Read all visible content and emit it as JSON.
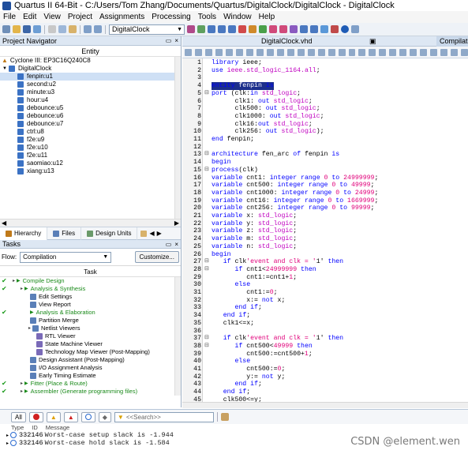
{
  "window": {
    "title": "Quartus II 64-Bit - C:/Users/Tom Zhang/Documents/Quartus/DigitalClock/DigitalClock - DigitalClock"
  },
  "menu": [
    "File",
    "Edit",
    "View",
    "Project",
    "Assignments",
    "Processing",
    "Tools",
    "Window",
    "Help"
  ],
  "toolbar": {
    "project_select": "DigitalClock"
  },
  "navigator": {
    "title": "Project Navigator",
    "entity_header": "Entity",
    "device": "Cyclone III: EP3C16Q240C8",
    "top": "DigitalClock",
    "entities": [
      {
        "label": "fenpin:u1",
        "selected": true
      },
      {
        "label": "second:u2"
      },
      {
        "label": "minute:u3"
      },
      {
        "label": "hour:u4"
      },
      {
        "label": "debounce:u5"
      },
      {
        "label": "debounce:u6"
      },
      {
        "label": "debounce:u7"
      },
      {
        "label": "ctrl:u8"
      },
      {
        "label": "f2e:u9"
      },
      {
        "label": "f2e:u10"
      },
      {
        "label": "f2e:u11"
      },
      {
        "label": "saomiao:u12"
      },
      {
        "label": "xiang:u13"
      }
    ],
    "tabs": [
      "Hierarchy",
      "Files",
      "Design Units"
    ]
  },
  "tasks": {
    "title": "Tasks",
    "flow_label": "Flow:",
    "flow_value": "Compilation",
    "customize_label": "Customize...",
    "column_header": "Task",
    "rows": [
      {
        "label": "Compile Design",
        "check": true,
        "level": 0,
        "green": true
      },
      {
        "label": "Analysis & Synthesis",
        "check": true,
        "level": 1,
        "green": true
      },
      {
        "label": "Edit Settings",
        "level": 2
      },
      {
        "label": "View Report",
        "level": 2
      },
      {
        "label": "Analysis & Elaboration",
        "check": true,
        "level": 2,
        "green": true
      },
      {
        "label": "Partition Merge",
        "level": 2
      },
      {
        "label": "Netlist Viewers",
        "level": 2
      },
      {
        "label": "RTL Viewer",
        "level": 3
      },
      {
        "label": "State Machine Viewer",
        "level": 3
      },
      {
        "label": "Technology Map Viewer (Post-Mapping)",
        "level": 3
      },
      {
        "label": "Design Assistant (Post-Mapping)",
        "level": 2
      },
      {
        "label": "I/O Assignment Analysis",
        "level": 2
      },
      {
        "label": "Early Timing Estimate",
        "level": 2
      },
      {
        "label": "Fitter (Place & Route)",
        "check": true,
        "level": 1,
        "green": true
      },
      {
        "label": "Assembler (Generate programming files)",
        "check": true,
        "level": 1,
        "green": true
      }
    ]
  },
  "editor": {
    "file_tab": "DigitalClock.vhd",
    "next_tab": "Compilati",
    "lines": [
      "library ieee;",
      "use ieee.std_logic_1164.all;",
      "",
      "entity fenpin is",
      "port (clk:in std_logic;",
      "      clk1: out std_logic;",
      "      clk500: out std_logic;",
      "      clk1000: out std_logic;",
      "      clk16:out std_logic;",
      "      clk256: out std_logic);",
      "end fenpin;",
      "",
      "architecture fen_arc of fenpin is",
      "begin",
      "process(clk)",
      "variable cnt1: integer range 0 to 24999999;",
      "variable cnt500: integer range 0 to 49999;",
      "variable cnt1000: integer range 0 to 24999;",
      "variable cnt16: integer range 0 to 1669999;",
      "variable cnt256: integer range 0 to 99999;",
      "variable x: std_logic;",
      "variable y: std_logic;",
      "variable z: std_logic;",
      "variable m: std_logic;",
      "variable n: std_logic;",
      "begin",
      "   if clk'event and clk = '1' then",
      "      if cnt1<24999999 then",
      "         cnt1:=cnt1+1;",
      "      else",
      "         cnt1:=0;",
      "         x:= not x;",
      "      end if;",
      "   end if;",
      "   clk1<=x;",
      "",
      "   if clk'event and clk = '1' then",
      "      if cnt500<49999 then",
      "         cnt500:=cnt500+1;",
      "      else",
      "         cnt500:=0;",
      "         y:= not y;",
      "      end if;",
      "   end if;",
      "   clk500<=y;"
    ],
    "highlight_line": 4
  },
  "messages": {
    "all_label": "All",
    "search_placeholder": "<<Search>>",
    "col_type": "Type",
    "col_id": "ID",
    "col_message": "Message",
    "rows": [
      {
        "id": "332146",
        "text": "Worst-case setup slack is -1.944"
      },
      {
        "id": "332146",
        "text": "Worst-case hold slack is -1.584"
      }
    ]
  },
  "watermark": "CSDN @element.wen",
  "colors": {
    "keyword": "#0000ff",
    "type": "#c000c0",
    "number": "#e0007a",
    "highlight": "#1c2f8c"
  }
}
